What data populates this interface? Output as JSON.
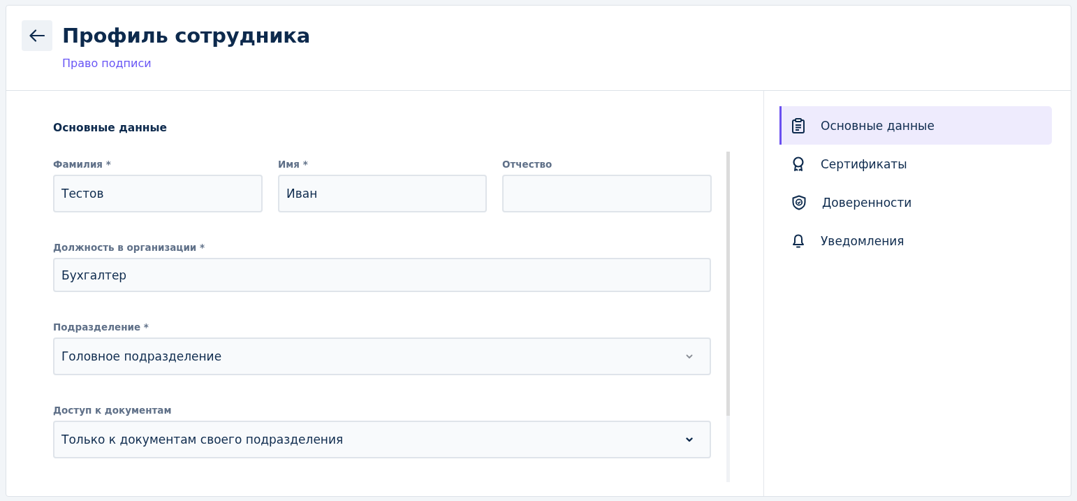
{
  "header": {
    "title": "Профиль сотрудника",
    "subtitle_link": "Право подписи"
  },
  "section_title": "Основные данные",
  "name_fields": [
    {
      "label": "Фамилия *",
      "value": "Тестов"
    },
    {
      "label": "Имя *",
      "value": "Иван"
    },
    {
      "label": "Отчество"
    }
  ],
  "position_field": {
    "label": "Должность в организации *",
    "value": "Бухгалтер"
  },
  "selects": [
    {
      "label": "Подразделение *",
      "value": "Головное подразделение",
      "disabled": true
    },
    {
      "label": "Доступ к документам",
      "value": "Только к документам своего подразделения",
      "disabled": false
    }
  ],
  "nav": [
    {
      "kind": "clipboard",
      "label": "Основные данные",
      "selected": true
    },
    {
      "kind": "award",
      "label": "Сертификаты",
      "selected": false
    },
    {
      "kind": "shield",
      "label": "Доверенности",
      "selected": false
    },
    {
      "kind": "bell",
      "label": "Уведомления",
      "selected": false
    }
  ]
}
